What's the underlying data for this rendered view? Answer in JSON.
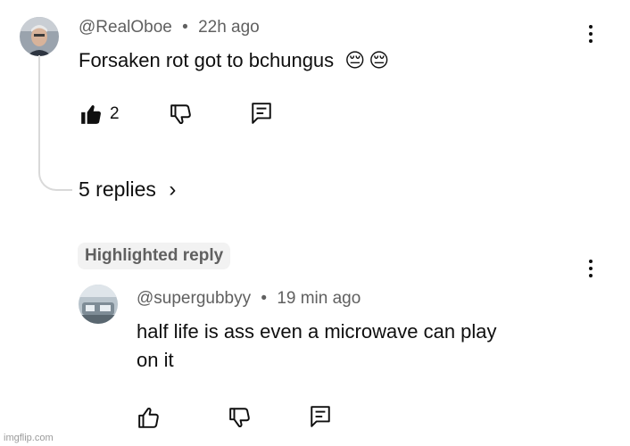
{
  "comment": {
    "handle": "@RealOboe",
    "separator": "•",
    "time": "22h ago",
    "text": "Forsaken rot got to bchungus",
    "emoji": [
      "😔",
      "😔"
    ],
    "like_count": "2"
  },
  "replies": {
    "label": "5 replies",
    "chevron": "›"
  },
  "highlight": {
    "label": "Highlighted reply"
  },
  "reply": {
    "handle": "@supergubbyy",
    "separator": "•",
    "time": "19 min ago",
    "text_line1": "half life is ass even a microwave can play",
    "text_line2": "on it"
  },
  "watermark": "imgflip.com",
  "icons": {
    "like_filled": "thumbs-up-filled-icon",
    "like": "thumbs-up-icon",
    "dislike": "thumbs-down-icon",
    "reply": "comment-reply-icon",
    "more": "more-vertical-icon"
  }
}
